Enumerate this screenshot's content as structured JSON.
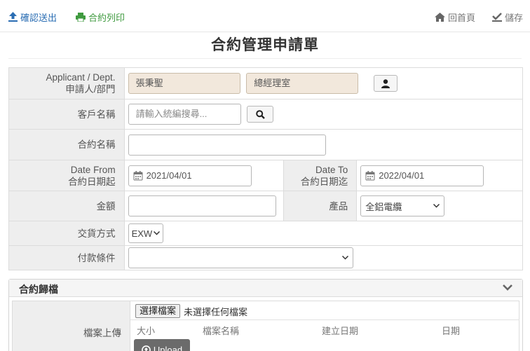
{
  "toolbar": {
    "submit_label": "確認送出",
    "print_label": "合約列印",
    "home_label": "回首頁",
    "save_label": "儲存"
  },
  "page": {
    "title": "合約管理申請單"
  },
  "form": {
    "applicant_label_en": "Applicant / Dept.",
    "applicant_label_zh": "申請人/部門",
    "applicant_name": "張秉聖",
    "applicant_dept": "總經理室",
    "customer_label": "客戶名稱",
    "customer_placeholder": "請輸入統編搜尋...",
    "contract_name_label": "合約名稱",
    "contract_name_value": "",
    "date_from_label_en": "Date From",
    "date_from_label_zh": "合約日期起",
    "date_from_value": "2021/04/01",
    "date_to_label_en": "Date To",
    "date_to_label_zh": "合約日期迄",
    "date_to_value": "2022/04/01",
    "amount_label": "金額",
    "amount_value": "",
    "product_label": "產品",
    "product_value": "全鋁電纜",
    "delivery_label": "交貨方式",
    "delivery_value": "EXW",
    "payment_label": "付款條件",
    "payment_value": ""
  },
  "archive": {
    "title": "合約歸檔",
    "upload_label": "檔案上傳",
    "choose_file_label": "選擇檔案",
    "no_file_text": "未選擇任何檔案",
    "columns": [
      "大小",
      "檔案名稱",
      "建立日期",
      "日期"
    ],
    "upload_button_label": "Upload"
  },
  "colors": {
    "accent_blue": "#2a6db3",
    "accent_green": "#3f9a3f",
    "readonly_bg": "#f2e8dc",
    "label_bg": "#eeeeee"
  }
}
